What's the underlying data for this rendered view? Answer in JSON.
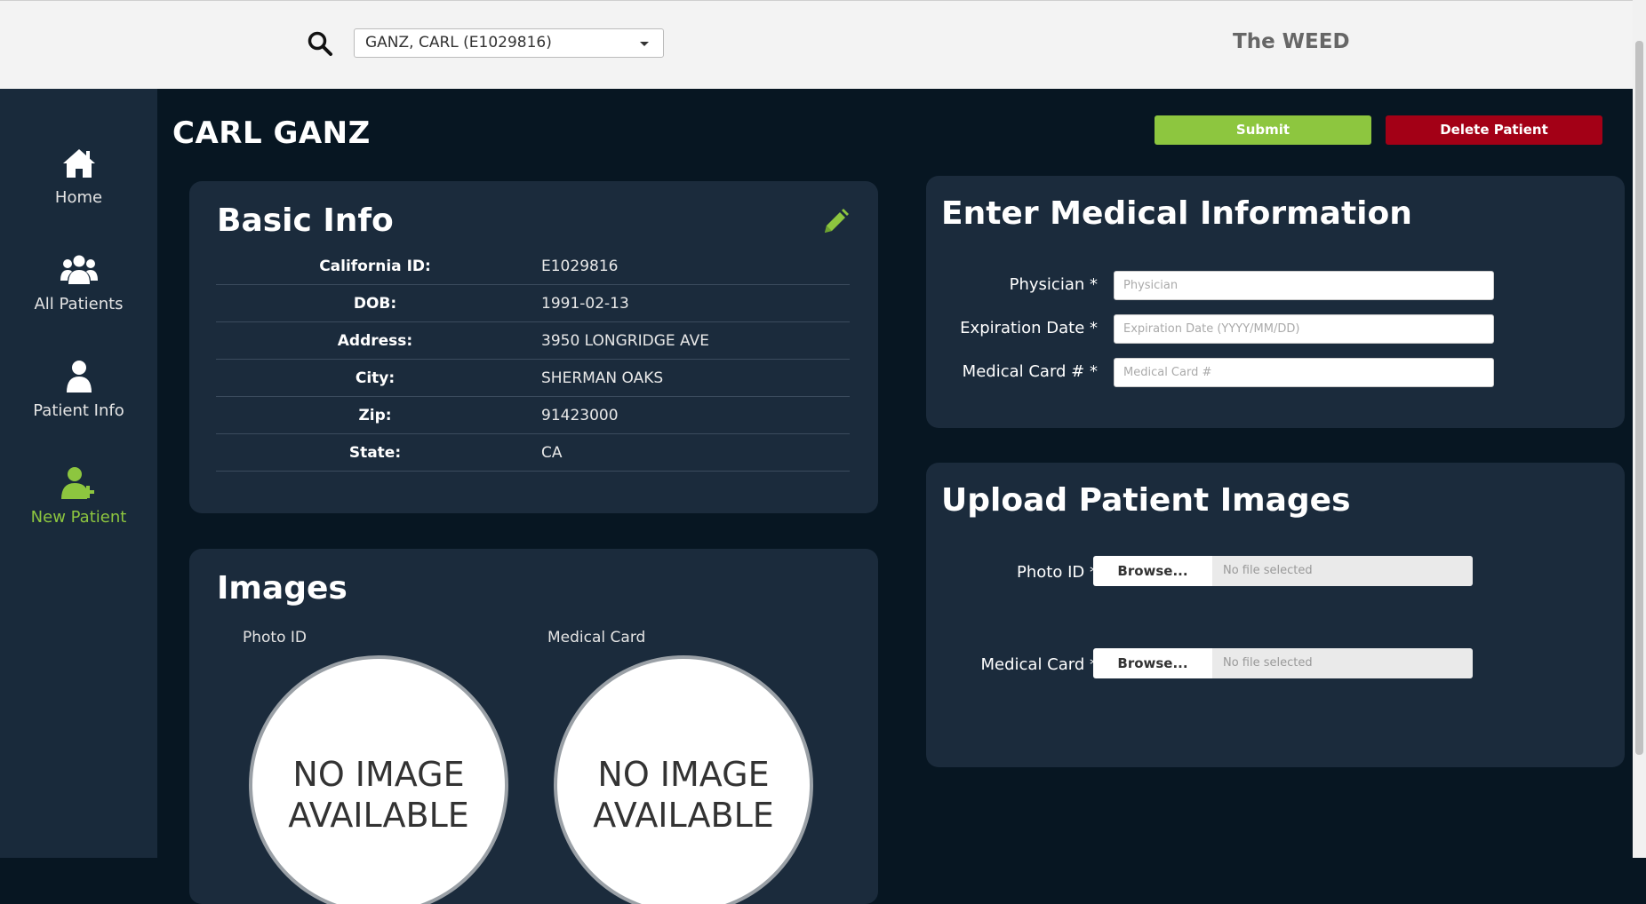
{
  "header": {
    "patient_select": "GANZ, CARL (E1029816)",
    "app_title": "The WEED"
  },
  "sidebar": {
    "items": [
      {
        "label": "Home",
        "icon": "home-icon"
      },
      {
        "label": "All Patients",
        "icon": "users-icon"
      },
      {
        "label": "Patient Info",
        "icon": "user-icon"
      },
      {
        "label": "New Patient",
        "icon": "user-plus-icon",
        "active": true
      }
    ]
  },
  "main": {
    "patient_name": "CARL GANZ",
    "submit_label": "Submit",
    "delete_label": "Delete Patient"
  },
  "basic_info": {
    "title": "Basic Info",
    "rows": [
      {
        "label": "California ID:",
        "value": "E1029816"
      },
      {
        "label": "DOB:",
        "value": "1991-02-13"
      },
      {
        "label": "Address:",
        "value": "3950 LONGRIDGE AVE"
      },
      {
        "label": "City:",
        "value": "SHERMAN OAKS"
      },
      {
        "label": "Zip:",
        "value": "91423000"
      },
      {
        "label": "State:",
        "value": "CA"
      }
    ]
  },
  "images": {
    "title": "Images",
    "photo_label": "Photo ID",
    "medical_label": "Medical Card",
    "no_image_line1": "NO IMAGE",
    "no_image_line2": "AVAILABLE"
  },
  "medical": {
    "title": "Enter Medical Information",
    "physician_label": "Physician *",
    "physician_placeholder": "Physician",
    "expiration_label": "Expiration Date *",
    "expiration_placeholder": "Expiration Date (YYYY/MM/DD)",
    "card_label": "Medical Card # *",
    "card_placeholder": "Medical Card #"
  },
  "upload": {
    "title": "Upload Patient Images",
    "photo_label": "Photo ID *",
    "medical_label": "Medical Card *",
    "browse_label": "Browse...",
    "no_file": "No file selected"
  },
  "colors": {
    "accent_green": "#8dc63f",
    "danger_red": "#a30016",
    "page_bg": "#071622",
    "card_bg": "#1b2b3c",
    "sidebar_bg": "#192a3b"
  }
}
